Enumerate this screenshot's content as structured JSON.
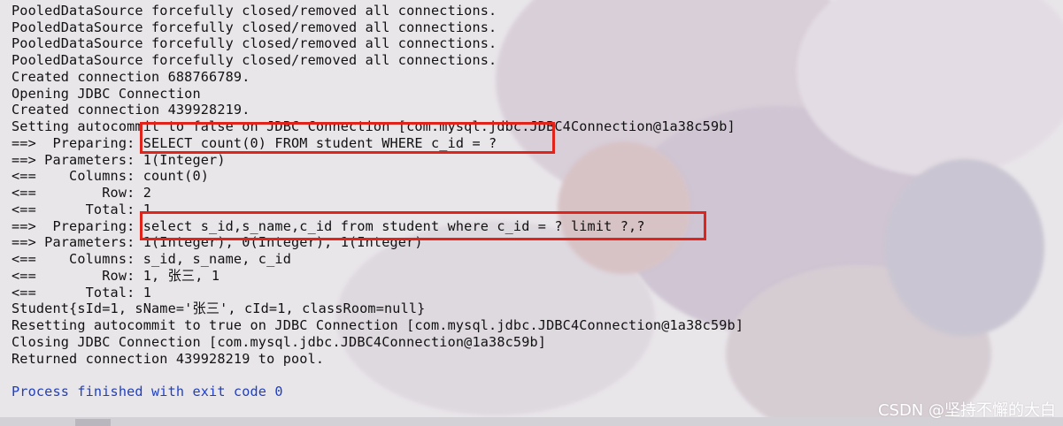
{
  "console": {
    "lines": [
      "PooledDataSource forcefully closed/removed all connections.",
      "PooledDataSource forcefully closed/removed all connections.",
      "PooledDataSource forcefully closed/removed all connections.",
      "PooledDataSource forcefully closed/removed all connections.",
      "Created connection 688766789.",
      "Opening JDBC Connection",
      "Created connection 439928219.",
      "Setting autocommit to false on JDBC Connection [com.mysql.jdbc.JDBC4Connection@1a38c59b]",
      "==>  Preparing: SELECT count(0) FROM student WHERE c_id = ?",
      "==> Parameters: 1(Integer)",
      "<==    Columns: count(0)",
      "<==        Row: 2",
      "<==      Total: 1",
      "==>  Preparing: select s_id,s_name,c_id from student where c_id = ? limit ?,?",
      "==> Parameters: 1(Integer), 0(Integer), 1(Integer)",
      "<==    Columns: s_id, s_name, c_id",
      "<==        Row: 1, 张三, 1",
      "<==      Total: 1",
      "Student{sId=1, sName='张三', cId=1, classRoom=null}",
      "Resetting autocommit to true on JDBC Connection [com.mysql.jdbc.JDBC4Connection@1a38c59b]",
      "Closing JDBC Connection [com.mysql.jdbc.JDBC4Connection@1a38c59b]",
      "Returned connection 439928219 to pool.",
      "",
      "Process finished with exit code 0"
    ]
  },
  "watermark": "CSDN @坚持不懈的大白",
  "colors": {
    "text": "#111111",
    "exit_text": "#1f3fc0",
    "highlight_border": "#e0241b"
  }
}
